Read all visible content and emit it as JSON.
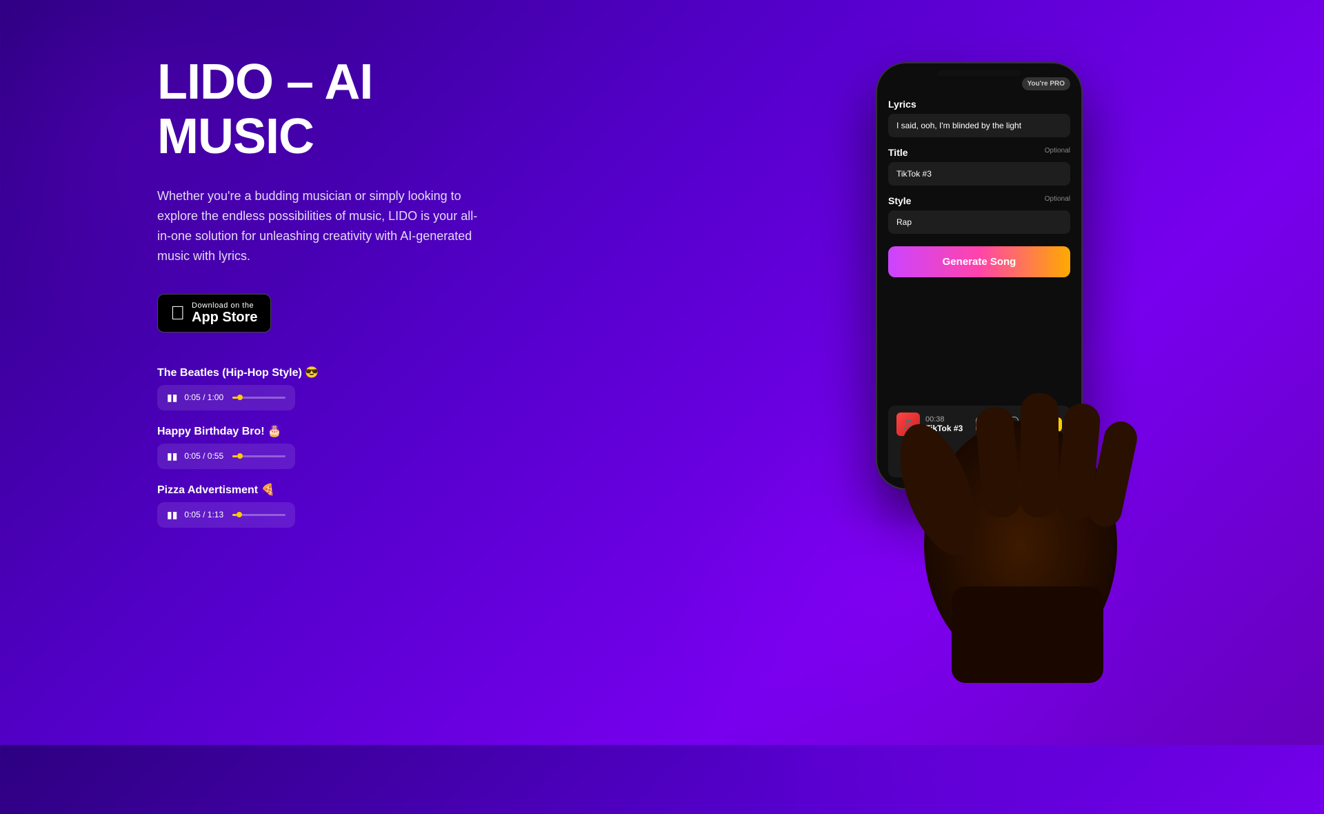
{
  "hero": {
    "title_line1": "LIDO – AI",
    "title_line2": "MUSIC",
    "description": "Whether you're a budding musician or simply looking to explore the endless possibilities of music, LIDO is your all-in-one solution for unleashing creativity with AI-generated music with lyrics."
  },
  "app_store": {
    "download_on": "Download on the",
    "store_name": "App Store"
  },
  "songs": [
    {
      "title": "The Beatles (Hip-Hop Style) 😎",
      "current_time": "0:05",
      "total_time": "1:00",
      "progress": 8
    },
    {
      "title": "Happy Birthday Bro! 🎂",
      "current_time": "0:05",
      "total_time": "0:55",
      "progress": 9
    },
    {
      "title": "Pizza Advertisment 🍕",
      "current_time": "0:05",
      "total_time": "1:13",
      "progress": 7
    }
  ],
  "phone": {
    "pro_badge": "You're PRO",
    "lyrics_label": "Lyrics",
    "lyrics_value": "I said, ooh, I'm blinded by the light",
    "title_label": "Title",
    "title_optional": "Optional",
    "title_value": "TikTok #3",
    "style_label": "Style",
    "style_optional": "Optional",
    "style_value": "Rap",
    "generate_btn": "Generate Song",
    "player_time": "00:38",
    "player_track": "TikTok #3",
    "copy_link_btn": "Copy Link",
    "share_btn": "SHARE"
  }
}
